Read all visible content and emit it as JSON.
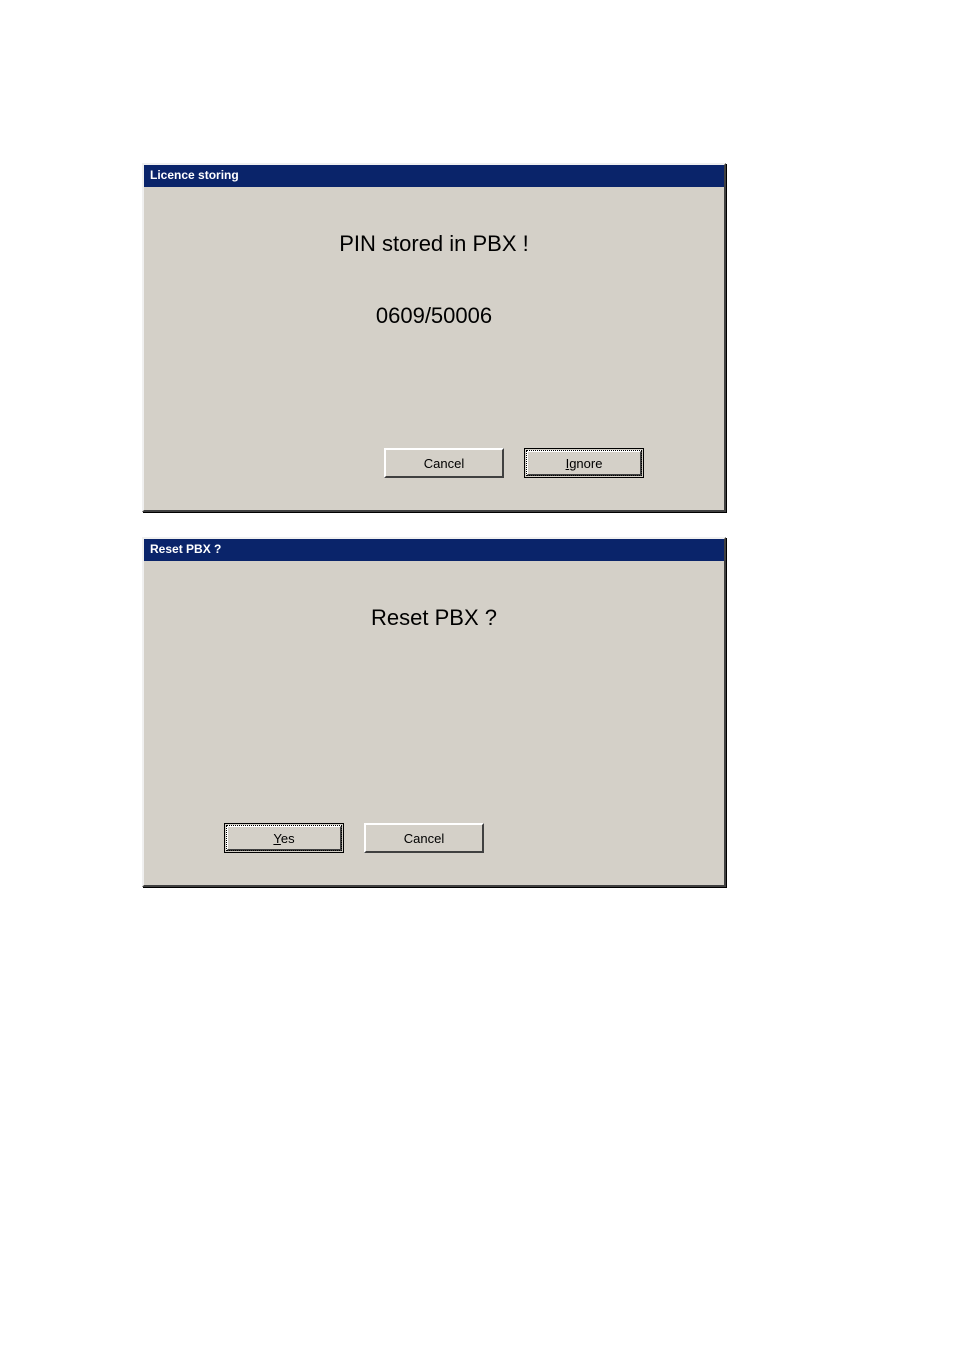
{
  "dialog1": {
    "title": "Licence storing",
    "message_line1": "PIN stored in PBX !",
    "message_line2": "0609/50006",
    "buttons": {
      "cancel": "Cancel",
      "ignore_prefix": "I",
      "ignore_rest": "gnore"
    }
  },
  "dialog2": {
    "title": "Reset PBX ?",
    "message_line1": "Reset PBX ?",
    "buttons": {
      "yes_prefix": "Y",
      "yes_rest": "es",
      "cancel": "Cancel"
    }
  }
}
